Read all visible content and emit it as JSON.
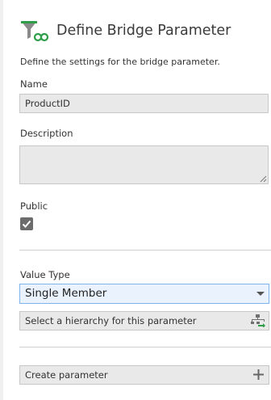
{
  "header": {
    "title": "Define Bridge Parameter",
    "icon": "filter-link-icon"
  },
  "intro": "Define the settings for the bridge parameter.",
  "name_field": {
    "label": "Name",
    "value": "ProductID"
  },
  "description_field": {
    "label": "Description",
    "value": ""
  },
  "public_field": {
    "label": "Public",
    "checked": true
  },
  "value_type": {
    "label": "Value Type",
    "selected": "Single Member"
  },
  "hierarchy": {
    "text": "Select a hierarchy for this parameter",
    "icon": "hierarchy-icon"
  },
  "create": {
    "label": "Create parameter",
    "icon": "plus-icon"
  },
  "colors": {
    "accent_green": "#2e9e48",
    "funnel_gray": "#8a8a8a",
    "select_border": "#7eb4ea"
  }
}
